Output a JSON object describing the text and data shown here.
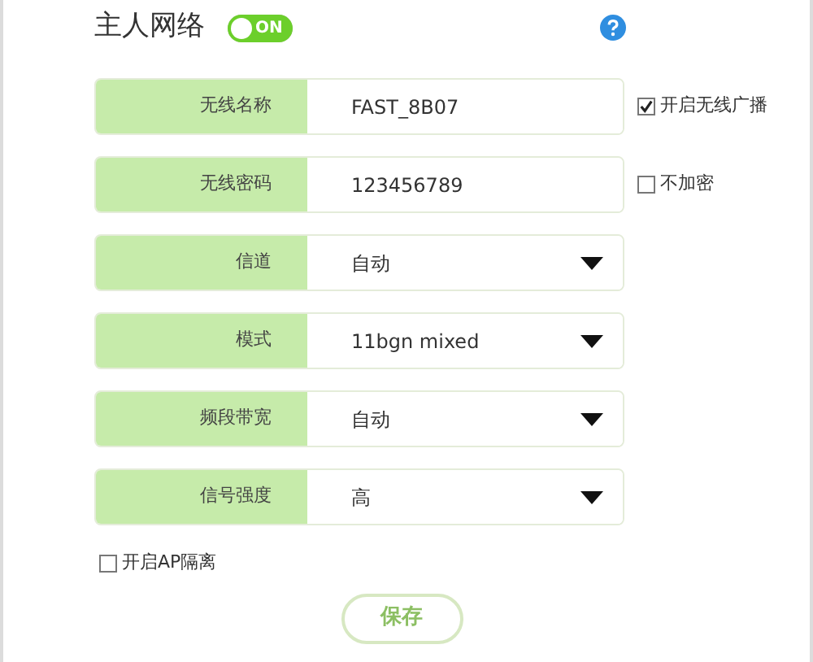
{
  "header": {
    "title": "主人网络",
    "toggle": {
      "label": "ON",
      "on": true
    }
  },
  "fields": [
    {
      "kind": "text",
      "label": "无线名称",
      "value": "FAST_8B07",
      "option": {
        "label": "开启无线广播",
        "checked": true
      }
    },
    {
      "kind": "text",
      "label": "无线密码",
      "value": "123456789",
      "option": {
        "label": "不加密",
        "checked": false
      }
    },
    {
      "kind": "select",
      "label": "信道",
      "value": "自动"
    },
    {
      "kind": "select",
      "label": "模式",
      "value": "11bgn mixed"
    },
    {
      "kind": "select",
      "label": "频段带宽",
      "value": "自动"
    },
    {
      "kind": "select",
      "label": "信号强度",
      "value": "高"
    }
  ],
  "ap_isolation": {
    "label": "开启AP隔离",
    "checked": false
  },
  "save_button": "保存"
}
